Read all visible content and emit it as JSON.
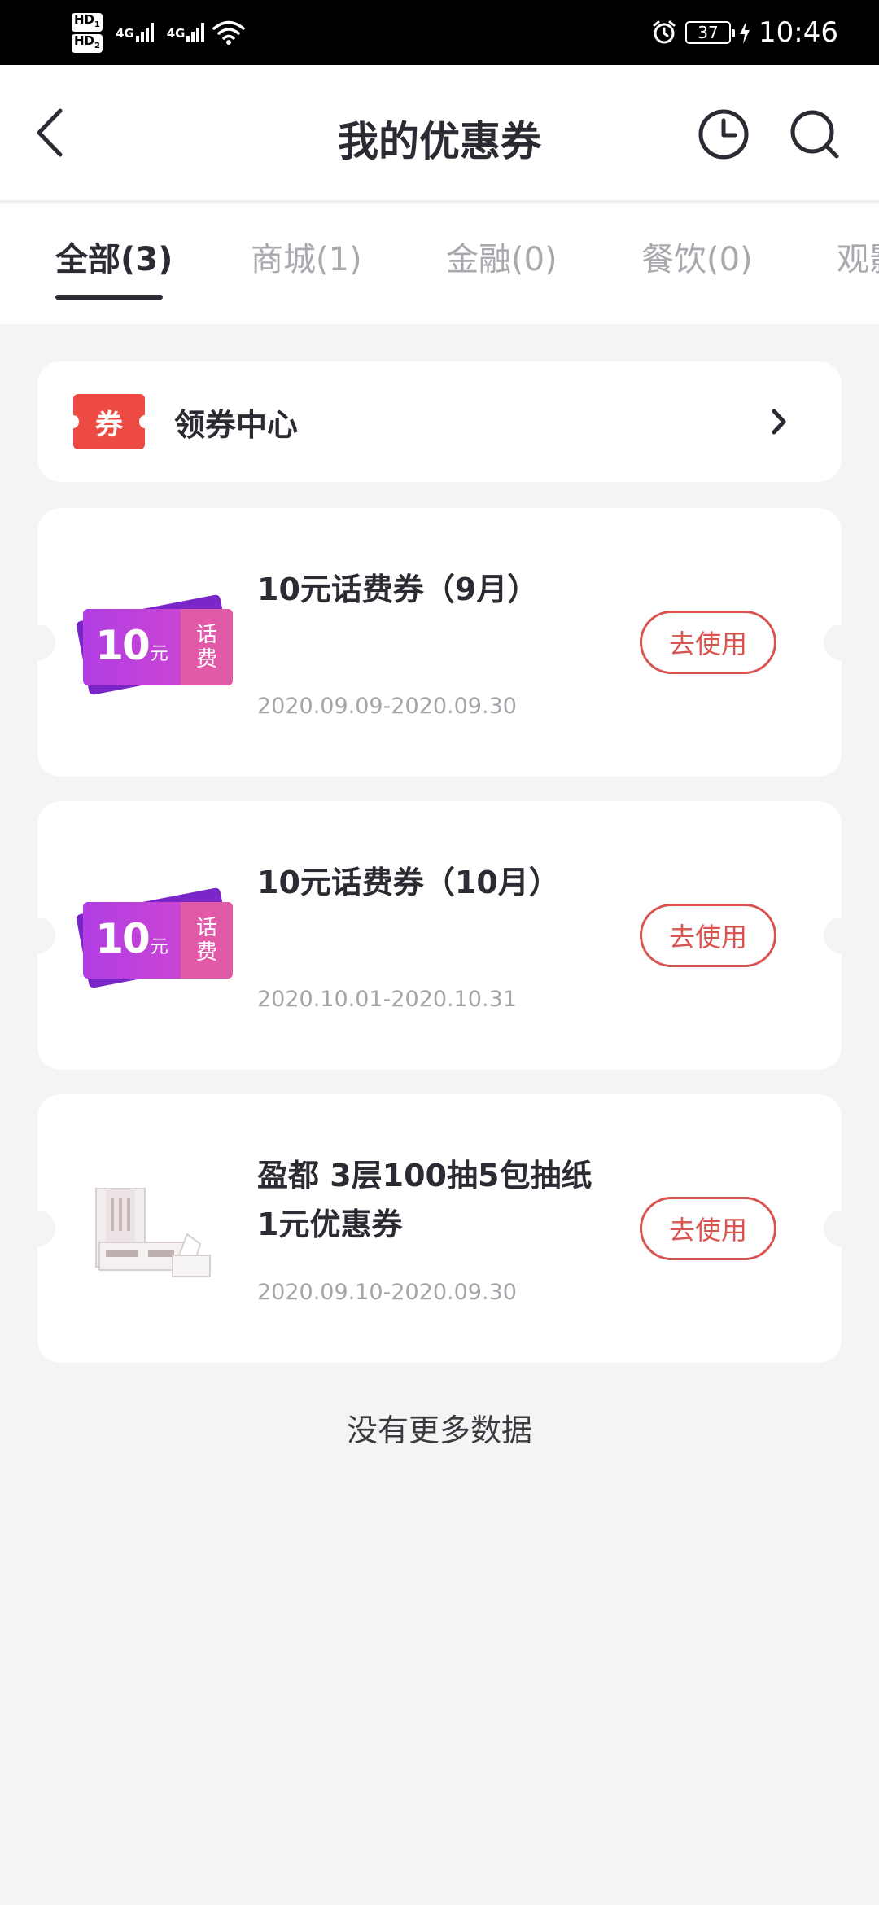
{
  "status_bar": {
    "hd1": "HD",
    "hd1_sub": "1",
    "hd2": "HD",
    "hd2_sub": "2",
    "net1": "4G",
    "net2": "4G",
    "battery": "37",
    "time": "10:46"
  },
  "header": {
    "title": "我的优惠券",
    "icons": [
      "back-icon",
      "history-clock-icon",
      "search-icon"
    ]
  },
  "tabs": [
    {
      "label": "全部(3)",
      "active": true
    },
    {
      "label": "商城(1)",
      "active": false
    },
    {
      "label": "金融(0)",
      "active": false
    },
    {
      "label": "餐饮(0)",
      "active": false
    },
    {
      "label": "观影",
      "active": false
    }
  ],
  "coupon_center": {
    "badge": "券",
    "label": "领券中心"
  },
  "coupons": [
    {
      "ticket_amount": "10",
      "ticket_unit": "元",
      "ticket_side_1": "话",
      "ticket_side_2": "费",
      "title": "10元话费券（9月）",
      "date": "2020.09.09-2020.09.30",
      "button": "去使用"
    },
    {
      "ticket_amount": "10",
      "ticket_unit": "元",
      "ticket_side_1": "话",
      "ticket_side_2": "费",
      "title": "10元话费券（10月）",
      "date": "2020.10.01-2020.10.31",
      "button": "去使用"
    },
    {
      "title": "盈都 3层100抽5包抽纸 1元优惠券",
      "date": "2020.09.10-2020.09.30",
      "button": "去使用"
    }
  ],
  "footer": {
    "no_more": "没有更多数据"
  },
  "colors": {
    "accent_red": "#d9534f",
    "badge_red": "#ee4a44",
    "ticket_purple": "#b23ee4"
  }
}
